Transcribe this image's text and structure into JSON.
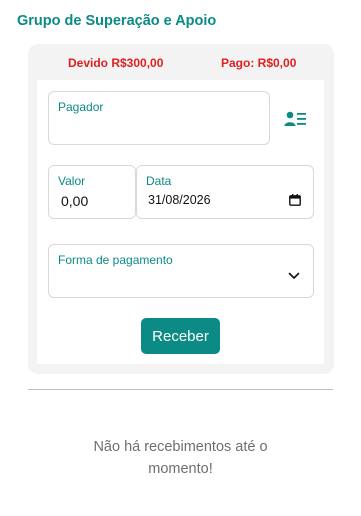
{
  "group": {
    "title": "Grupo de Superação e Apoio"
  },
  "summary": {
    "owed_label": "Devido R$300,00",
    "paid_label": "Pago: R$0,00"
  },
  "form": {
    "payer": {
      "label": "Pagador",
      "value": ""
    },
    "payer_list_icon": "person-list-icon",
    "amount": {
      "label": "Valor",
      "value": "0,00"
    },
    "date": {
      "label": "Data",
      "value": "31/08/2026"
    },
    "payment_method": {
      "label": "Forma de pagamento",
      "value": ""
    },
    "submit_label": "Receber"
  },
  "receipts": {
    "empty_line1": "Não há recebimentos até o",
    "empty_line2": "momento!"
  },
  "colors": {
    "accent": "#0b8a86",
    "alert": "#e02020",
    "card_bg": "#f3f3f3",
    "muted_text": "#6f6f6f"
  }
}
